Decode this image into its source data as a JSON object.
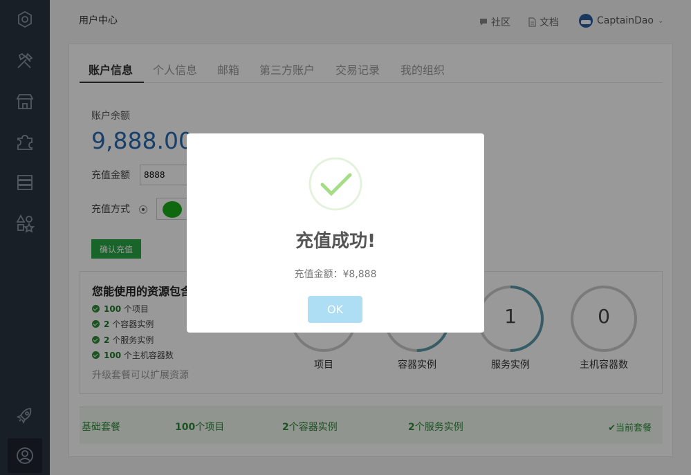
{
  "header": {
    "title": "用户中心",
    "community": "社区",
    "docs": "文档",
    "username": "CaptainDao"
  },
  "tabs": [
    {
      "label": "账户信息"
    },
    {
      "label": "个人信息"
    },
    {
      "label": "邮箱"
    },
    {
      "label": "第三方账户"
    },
    {
      "label": "交易记录"
    },
    {
      "label": "我的组织"
    }
  ],
  "account": {
    "balance_label": "账户余额",
    "balance": "9,888.00",
    "recharge_amount_label": "充值金额",
    "recharge_amount_value": "8888",
    "payment_method_label": "充值方式",
    "confirm_label": "确认充值"
  },
  "resources": {
    "title": "您能使用的资源包含",
    "items": [
      {
        "count": "100",
        "text": "个项目"
      },
      {
        "count": "2",
        "text": "个容器实例"
      },
      {
        "count": "2",
        "text": "个服务实例"
      },
      {
        "count": "100",
        "text": "个主机容器数"
      }
    ],
    "upgrade_text": "升级套餐可以扩展资源",
    "gauges": [
      {
        "label": "项目",
        "value": "",
        "fraction": 0.0
      },
      {
        "label": "容器实例",
        "value": "",
        "fraction": 0.5
      },
      {
        "label": "服务实例",
        "value": "1",
        "fraction": 0.5
      },
      {
        "label": "主机容器数",
        "value": "0",
        "fraction": 0.0
      }
    ]
  },
  "plan": {
    "name": "基础套餐",
    "projects_count": "100",
    "projects_text": "个项目",
    "containers_count": "2",
    "containers_text": "个容器实例",
    "services_count": "2",
    "services_text": "个服务实例",
    "current": "当前套餐"
  },
  "modal": {
    "title": "充值成功!",
    "text": "充值金额：¥8,888",
    "ok_label": "OK"
  },
  "colors": {
    "accent": "#2a6cb0",
    "success": "#28a745",
    "gauge": "#5b9aa8",
    "ok_button": "#aedef4"
  }
}
